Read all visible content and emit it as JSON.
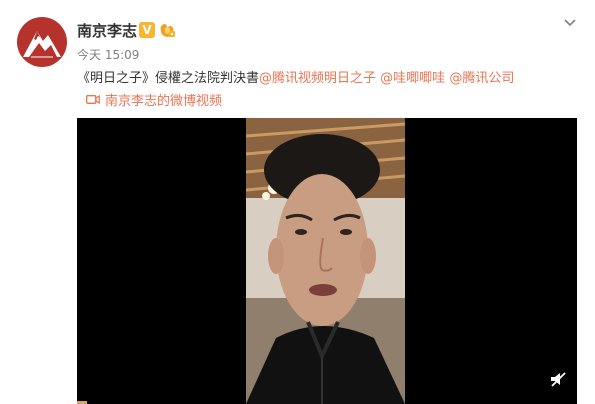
{
  "post": {
    "username": "南京李志",
    "verified_badge": "V",
    "timestamp": "今天 15:09",
    "text_prefix": "《明日之子》侵權之法院判決書",
    "mentions": [
      "@腾讯视频明日之子",
      "@哇唧唧哇",
      "@腾讯公司"
    ],
    "video_link_label": "南京李志的微博视频"
  },
  "icons": {
    "more": "chevron-down-icon",
    "video_link": "video-camera-icon",
    "mute": "mute-icon",
    "level_badge": "level-badge-icon"
  },
  "colors": {
    "mention": "#eb7350",
    "username": "#333333",
    "timestamp": "#808080",
    "verified_badge": "#f7b530",
    "avatar_bg": "#b5322d",
    "video_bg": "#000000"
  }
}
